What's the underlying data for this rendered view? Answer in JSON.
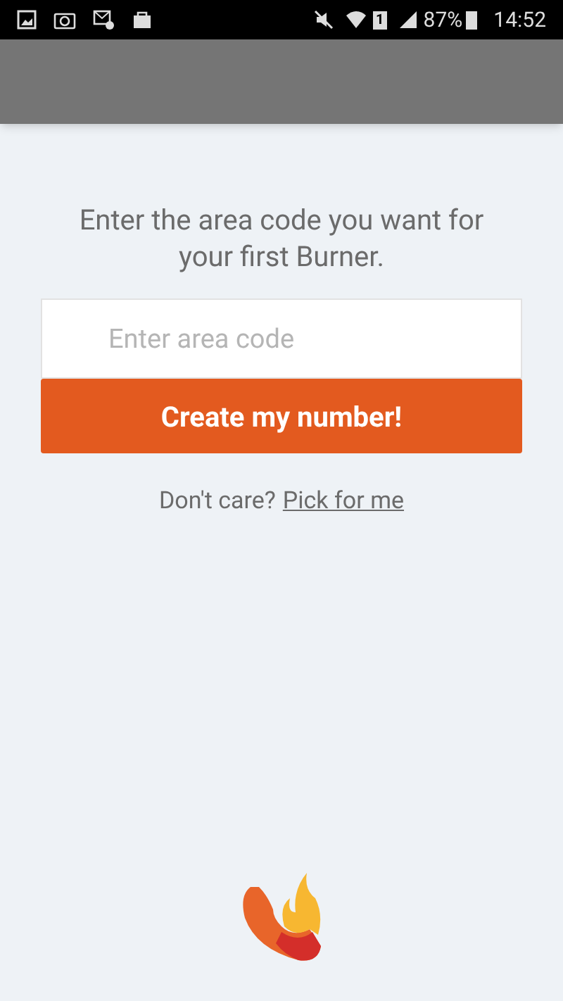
{
  "status_bar": {
    "sim": "1",
    "battery": "87%",
    "time": "14:52"
  },
  "prompt": "Enter the area code you want for your first Burner.",
  "area_code_field": {
    "placeholder": "Enter area code"
  },
  "create_button": "Create my number!",
  "pick_prompt": "Don't care?",
  "pick_link": "Pick for me"
}
